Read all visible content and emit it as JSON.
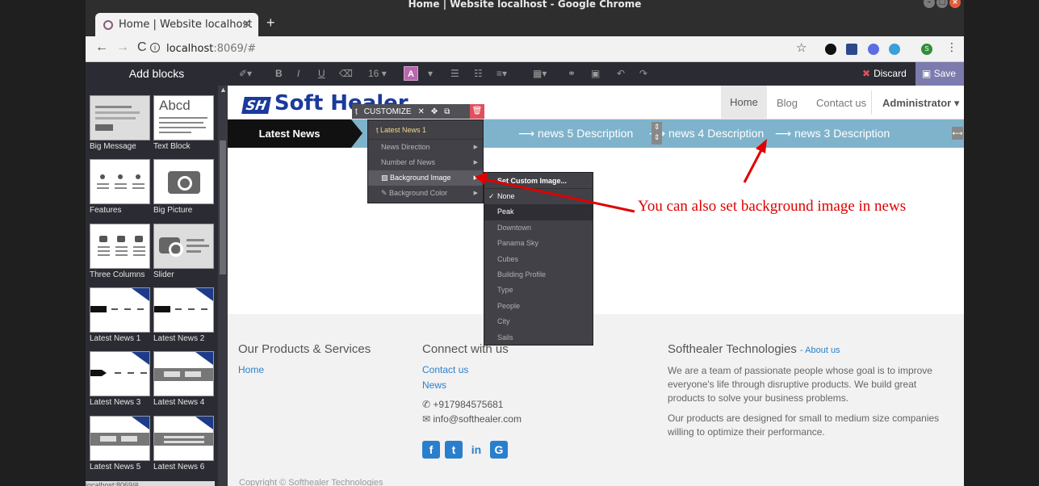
{
  "window": {
    "title": "Home | Website localhost - Google Chrome"
  },
  "tab": {
    "title": "Home | Website localhost",
    "close": "×",
    "new_tab": "+"
  },
  "address": {
    "host": "localhost",
    "rest": ":8069/#"
  },
  "toolbar": {
    "add_blocks": "Add blocks",
    "font_size": "16",
    "color_letter": "A",
    "discard": "Discard",
    "save": "Save",
    "profile_initial": "S"
  },
  "blocks": [
    {
      "label": "Big Message"
    },
    {
      "label": "Text Block",
      "thumb_text": "Abcd"
    },
    {
      "label": "Features"
    },
    {
      "label": "Big Picture"
    },
    {
      "label": "Three Columns"
    },
    {
      "label": "Slider"
    },
    {
      "label": "Latest News 1"
    },
    {
      "label": "Latest News 2"
    },
    {
      "label": "Latest News 3"
    },
    {
      "label": "Latest News 4"
    },
    {
      "label": "Latest News 5"
    },
    {
      "label": "Latest News 6"
    }
  ],
  "site": {
    "logo_text": "Soft Healer",
    "logo_mark": "SH",
    "menu": {
      "home": "Home",
      "blog": "Blog",
      "contact": "Contact us",
      "admin": "Administrator"
    },
    "news": {
      "label": "Latest News",
      "items": [
        "news 5 Description",
        "news 4 Description",
        "news 3 Description"
      ]
    },
    "footer": {
      "col1": {
        "title": "Our Products & Services",
        "links": [
          "Home"
        ]
      },
      "col2": {
        "title": "Connect with us",
        "links": [
          "Contact us",
          "News"
        ],
        "phone": "+917984575681",
        "email": "info@softhealer.com"
      },
      "col3": {
        "title": "Softhealer Technologies",
        "about": "About us",
        "p1": "We are a team of passionate people whose goal is to improve everyone's life through disruptive products. We build great products to solve your business problems.",
        "p2": "Our products are designed for small to medium size companies willing to optimize their performance."
      },
      "copyright": "Copyright © Softhealer Technologies"
    }
  },
  "customize": {
    "bar_label": "CUSTOMIZE",
    "menu_head": "Latest News 1",
    "items": [
      "News Direction",
      "Number of News",
      "Background Image",
      "Background Color"
    ],
    "bg_menu_head": "Set Custom Image...",
    "bg_options": [
      "None",
      "Peak",
      "Downtown",
      "Panama Sky",
      "Cubes",
      "Building Profile",
      "Type",
      "People",
      "City",
      "Sails"
    ]
  },
  "annotation": {
    "text": "You can also set background image in news"
  },
  "status": {
    "url": "localhost:8069/#"
  }
}
